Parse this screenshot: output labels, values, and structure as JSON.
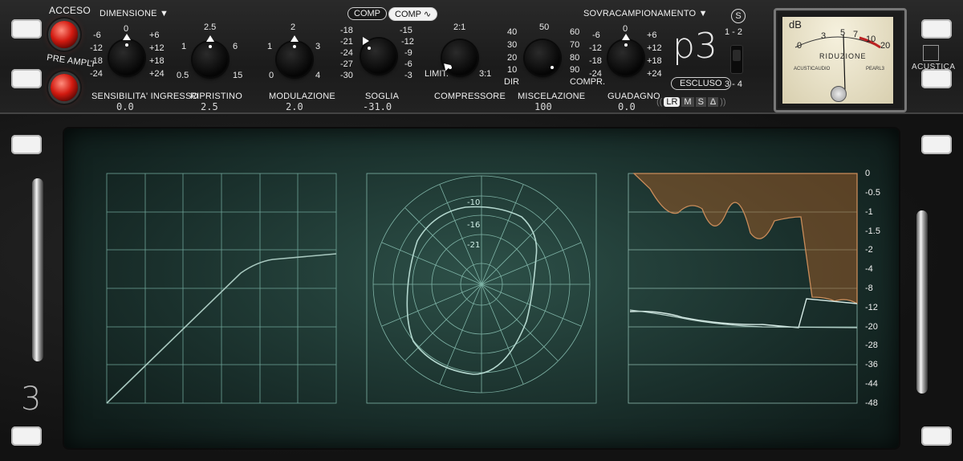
{
  "top": {
    "power_label": "ACCESO",
    "preamp_label": "PRE AMPLI",
    "dimension_label": "DIMENSIONE",
    "oversample_label": "SOVRACAMPIONAMENTO",
    "comp_btn1": "COMP",
    "comp_btn2": "COMP",
    "logo": "p3",
    "bypass_label": "ESCLUSO",
    "mode_items": [
      "LR",
      "M",
      "S",
      "Δ"
    ],
    "sidechain_icon": "S",
    "switch_top": "1 - 2",
    "switch_bottom": "3 - 4",
    "brand": "ACUSTICA"
  },
  "knobs": {
    "input": {
      "label": "SENSIBILITA' INGRESSO",
      "value": "0.0",
      "ticks": [
        "-6",
        "0",
        "+6",
        "-12",
        "+12",
        "-18",
        "+18",
        "-24",
        "+24"
      ]
    },
    "recovery": {
      "label": "RIPRISTINO",
      "value": "2.5",
      "ticks": [
        "2.5",
        "1",
        "6",
        "0.5",
        "15"
      ]
    },
    "modulation": {
      "label": "MODULAZIONE",
      "value": "2.0",
      "ticks": [
        "2",
        "1",
        "3",
        "0",
        "4"
      ]
    },
    "threshold": {
      "label": "SOGLIA",
      "value": "-31.0",
      "ticks": [
        "-18",
        "-15",
        "-21",
        "-12",
        "-24",
        "-9",
        "-27",
        "-6",
        "-30",
        "-3"
      ]
    },
    "compressor": {
      "label": "COMPRESSORE",
      "value": "",
      "ticks": [
        "2:1",
        "LIMIT.",
        "3:1"
      ]
    },
    "mix": {
      "label": "MISCELAZIONE",
      "value": "100",
      "ticks": [
        "50",
        "40",
        "60",
        "30",
        "70",
        "20",
        "80",
        "10",
        "90",
        "DIR",
        "COMPR."
      ]
    },
    "gain": {
      "label": "GUADAGNO",
      "value": "0.0",
      "ticks": [
        "0",
        "-6",
        "+6",
        "-12",
        "+12",
        "-18",
        "+18",
        "-24",
        "+24"
      ]
    }
  },
  "meter": {
    "db_label": "dB",
    "scale": [
      "0",
      "3",
      "5",
      "7",
      "10",
      "20"
    ],
    "title": "RIDUZIONE",
    "left_text": "ACUSTICAUDIO",
    "right_text": "PEARL3"
  },
  "display": {
    "polar_labels": [
      "-10",
      "-16",
      "-21"
    ],
    "db_scale": [
      "0",
      "-0.5",
      "-1",
      "-1.5",
      "-2",
      "-4",
      "-8",
      "-12",
      "-20",
      "-28",
      "-36",
      "-44",
      "-48"
    ],
    "rack_number": "3"
  }
}
